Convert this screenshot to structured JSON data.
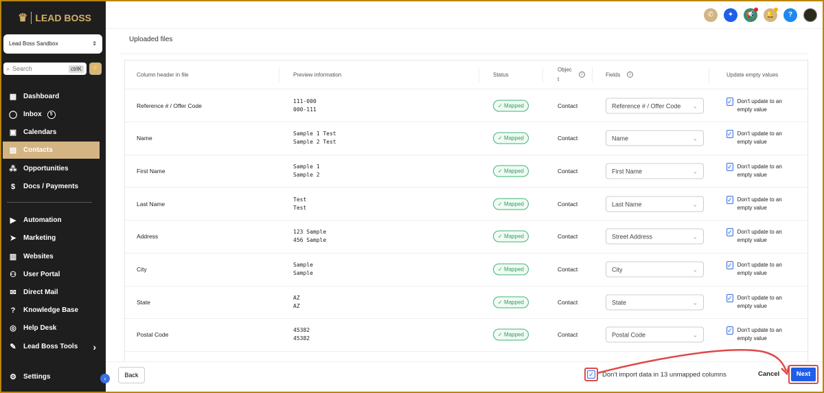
{
  "brand": "LEAD BOSS",
  "account": "Lead Boss Sandbox",
  "search": {
    "placeholder": "Search",
    "shortcut": "ctrlK"
  },
  "nav": [
    {
      "label": "Dashboard",
      "icon": "dashboard-icon",
      "glyph": "▦"
    },
    {
      "label": "Inbox",
      "icon": "chat-icon",
      "glyph": "◯",
      "badge": "5"
    },
    {
      "label": "Calendars",
      "icon": "calendar-icon",
      "glyph": "▣"
    },
    {
      "label": "Contacts",
      "icon": "contacts-icon",
      "glyph": "▤",
      "active": true
    },
    {
      "label": "Opportunities",
      "icon": "opportunities-icon",
      "glyph": "⁂"
    },
    {
      "label": "Docs / Payments",
      "icon": "docs-icon",
      "glyph": "$"
    },
    {
      "label": "Automation",
      "icon": "automation-icon",
      "glyph": "▶"
    },
    {
      "label": "Marketing",
      "icon": "marketing-icon",
      "glyph": "➤"
    },
    {
      "label": "Websites",
      "icon": "websites-icon",
      "glyph": "▥"
    },
    {
      "label": "User Portal",
      "icon": "user-portal-icon",
      "glyph": "⚇"
    },
    {
      "label": "Direct Mail",
      "icon": "mail-icon",
      "glyph": "✉"
    },
    {
      "label": "Knowledge Base",
      "icon": "knowledge-icon",
      "glyph": "?"
    },
    {
      "label": "Help Desk",
      "icon": "helpdesk-icon",
      "glyph": "◎"
    },
    {
      "label": "Lead Boss Tools",
      "icon": "wrench-icon",
      "glyph": "✎",
      "chevron": "›"
    }
  ],
  "settings": "Settings",
  "page": {
    "title": "Uploaded files"
  },
  "table": {
    "headers": [
      "Column header in file",
      "Preview information",
      "Status",
      "Objec t",
      "Fields",
      "Update empty values"
    ],
    "rows": [
      {
        "col": "Reference # / Offer Code",
        "p1": "111-000",
        "p2": "000-111",
        "status": "Mapped",
        "object": "Contact",
        "field": "Reference # / Offer Code",
        "upd": "Don't update to an empty value"
      },
      {
        "col": "Name",
        "p1": "Sample 1 Test",
        "p2": "Sample 2 Test",
        "status": "Mapped",
        "object": "Contact",
        "field": "Name",
        "upd": "Don't update to an empty value"
      },
      {
        "col": "First Name",
        "p1": "Sample 1",
        "p2": "Sample 2",
        "status": "Mapped",
        "object": "Contact",
        "field": "First Name",
        "upd": "Don't update to an empty value"
      },
      {
        "col": "Last Name",
        "p1": "Test",
        "p2": "Test",
        "status": "Mapped",
        "object": "Contact",
        "field": "Last Name",
        "upd": "Don't update to an empty value"
      },
      {
        "col": "Address",
        "p1": "123 Sample",
        "p2": "456 Sample",
        "status": "Mapped",
        "object": "Contact",
        "field": "Street Address",
        "upd": "Don't update to an empty value"
      },
      {
        "col": "City",
        "p1": "Sample",
        "p2": "Sample",
        "status": "Mapped",
        "object": "Contact",
        "field": "City",
        "upd": "Don't update to an empty value"
      },
      {
        "col": "State",
        "p1": "AZ",
        "p2": "AZ",
        "status": "Mapped",
        "object": "Contact",
        "field": "State",
        "upd": "Don't update to an empty value"
      },
      {
        "col": "Postal Code",
        "p1": "45382",
        "p2": "45382",
        "status": "Mapped",
        "object": "Contact",
        "field": "Postal Code",
        "upd": "Don't update to an empty value"
      }
    ]
  },
  "footer": {
    "back": "Back",
    "unmapped": "Don't import data in 13 unmapped columns",
    "cancel": "Cancel",
    "next": "Next"
  },
  "colors": {
    "accent": "#d4b483",
    "primary": "#1f5ee8",
    "highlight": "#e04848"
  }
}
